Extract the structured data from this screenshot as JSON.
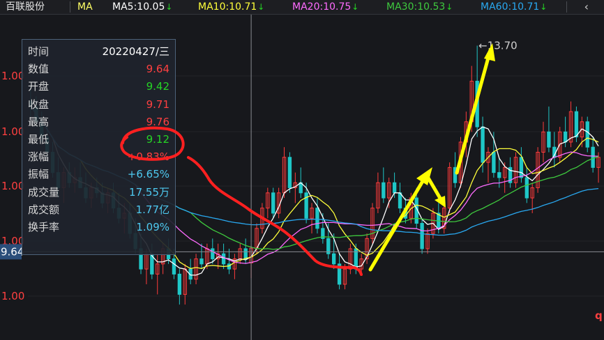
{
  "header": {
    "stock_name": "百联股份",
    "ma_label": "MA",
    "ma": [
      {
        "label": "MA5:10.05",
        "color": "#ffffff"
      },
      {
        "label": "MA10:10.71",
        "color": "#ffff3a"
      },
      {
        "label": "MA20:10.75",
        "color": "#ff6bff"
      },
      {
        "label": "MA30:10.53",
        "color": "#3ec93e"
      },
      {
        "label": "MA60:10.71",
        "color": "#29a8f0"
      }
    ],
    "down_arrow": "↓",
    "back_icon": "‹"
  },
  "tooltip": {
    "rows": [
      {
        "label": "时间",
        "value": "20220427/三",
        "color": "#ffffff"
      },
      {
        "label": "数值",
        "value": "9.64",
        "color": "#ff4040"
      },
      {
        "label": "开盘",
        "value": "9.42",
        "color": "#25d425"
      },
      {
        "label": "收盘",
        "value": "9.71",
        "color": "#ff4040"
      },
      {
        "label": "最高",
        "value": "9.76",
        "color": "#ff4040"
      },
      {
        "label": "最低",
        "value": "9.12",
        "color": "#25d425"
      },
      {
        "label": "涨幅",
        "value": "+0.83%",
        "color": "#ff4040"
      },
      {
        "label": "振幅",
        "value": "+6.65%",
        "color": "#4ec9f0"
      },
      {
        "label": "成交量",
        "value": "17.55万",
        "color": "#4ec9f0"
      },
      {
        "label": "成交额",
        "value": "1.77亿",
        "color": "#4ec9f0"
      },
      {
        "label": "换手率",
        "value": "1.09%",
        "color": "#4ec9f0"
      }
    ]
  },
  "chart_data": {
    "type": "candlestick",
    "y_tick_labels": [
      "1.00",
      "1.00",
      "1.00",
      "1.00",
      "1.00"
    ],
    "crosshair_price_label": "9.64",
    "max_annotation": "←13.70",
    "max_value": 13.7,
    "corner_label": "q",
    "ylim": [
      8.3,
      14.2
    ],
    "up_color": "#ff3b3b",
    "down_color": "#1fc7c7",
    "candles": [
      [
        12.6,
        12.9,
        12.3,
        12.5
      ],
      [
        12.5,
        12.7,
        12.1,
        12.2
      ],
      [
        12.2,
        12.4,
        11.8,
        11.9
      ],
      [
        11.9,
        12.1,
        11.5,
        11.6
      ],
      [
        11.6,
        11.8,
        11.1,
        11.2
      ],
      [
        11.2,
        11.5,
        10.7,
        10.9
      ],
      [
        10.9,
        11.3,
        10.6,
        11.2
      ],
      [
        11.2,
        11.4,
        10.9,
        11.0
      ],
      [
        11.0,
        11.3,
        10.8,
        11.1
      ],
      [
        11.1,
        11.4,
        10.9,
        10.9
      ],
      [
        10.9,
        11.2,
        10.6,
        10.7
      ],
      [
        10.7,
        11.0,
        10.5,
        10.9
      ],
      [
        10.9,
        11.1,
        10.7,
        10.8
      ],
      [
        10.8,
        11.0,
        10.5,
        10.6
      ],
      [
        10.6,
        10.9,
        10.4,
        10.8
      ],
      [
        10.8,
        11.0,
        10.4,
        10.5
      ],
      [
        10.5,
        10.8,
        10.2,
        10.3
      ],
      [
        10.3,
        10.6,
        10.0,
        10.4
      ],
      [
        10.4,
        10.6,
        9.9,
        10.0
      ],
      [
        10.0,
        10.3,
        9.6,
        9.7
      ],
      [
        9.7,
        10.0,
        9.2,
        9.3
      ],
      [
        9.3,
        9.7,
        9.0,
        9.6
      ],
      [
        9.6,
        9.8,
        9.1,
        9.2
      ],
      [
        9.2,
        9.6,
        8.8,
        9.4
      ],
      [
        9.4,
        9.8,
        9.2,
        9.7
      ],
      [
        9.7,
        9.9,
        9.4,
        9.5
      ],
      [
        9.5,
        9.7,
        9.1,
        9.2
      ],
      [
        9.2,
        9.3,
        8.6,
        8.8
      ],
      [
        8.8,
        9.4,
        8.6,
        9.3
      ],
      [
        9.3,
        9.5,
        9.0,
        9.1
      ],
      [
        9.1,
        9.6,
        9.0,
        9.5
      ],
      [
        9.5,
        9.8,
        9.3,
        9.4
      ],
      [
        9.4,
        9.8,
        9.3,
        9.7
      ],
      [
        9.7,
        9.9,
        9.4,
        9.5
      ],
      [
        9.5,
        9.8,
        9.3,
        9.6
      ],
      [
        9.6,
        9.8,
        9.3,
        9.4
      ],
      [
        9.4,
        9.7,
        9.2,
        9.3
      ],
      [
        9.3,
        9.6,
        9.1,
        9.5
      ],
      [
        9.5,
        9.8,
        9.4,
        9.7
      ],
      [
        9.7,
        9.9,
        9.4,
        9.5
      ],
      [
        9.42,
        9.76,
        9.12,
        9.71
      ],
      [
        9.7,
        10.2,
        9.6,
        10.1
      ],
      [
        10.1,
        10.6,
        10.0,
        10.5
      ],
      [
        10.5,
        10.9,
        10.3,
        10.8
      ],
      [
        10.8,
        10.9,
        10.3,
        10.4
      ],
      [
        10.4,
        10.9,
        10.3,
        10.8
      ],
      [
        10.8,
        11.7,
        10.7,
        11.5
      ],
      [
        11.5,
        11.6,
        10.8,
        10.9
      ],
      [
        10.9,
        11.2,
        10.6,
        11.0
      ],
      [
        11.0,
        11.3,
        10.7,
        10.8
      ],
      [
        10.8,
        11.0,
        10.2,
        10.3
      ],
      [
        10.3,
        10.6,
        10.0,
        10.5
      ],
      [
        10.5,
        10.7,
        10.0,
        10.1
      ],
      [
        10.1,
        10.4,
        9.8,
        9.9
      ],
      [
        9.9,
        10.2,
        9.5,
        9.6
      ],
      [
        9.6,
        10.0,
        9.3,
        9.4
      ],
      [
        9.4,
        9.6,
        8.9,
        9.0
      ],
      [
        9.0,
        9.4,
        8.9,
        9.3
      ],
      [
        9.3,
        9.8,
        9.2,
        9.7
      ],
      [
        9.7,
        9.8,
        9.2,
        9.3
      ],
      [
        9.3,
        9.6,
        9.2,
        9.5
      ],
      [
        9.5,
        10.0,
        9.4,
        9.9
      ],
      [
        9.9,
        10.6,
        9.8,
        10.5
      ],
      [
        10.5,
        11.2,
        10.4,
        11.0
      ],
      [
        11.0,
        11.3,
        10.6,
        10.7
      ],
      [
        10.7,
        11.1,
        10.5,
        11.0
      ],
      [
        11.0,
        11.2,
        10.7,
        10.8
      ],
      [
        10.8,
        11.0,
        10.4,
        10.5
      ],
      [
        10.5,
        10.7,
        10.2,
        10.3
      ],
      [
        10.3,
        10.8,
        10.2,
        10.7
      ],
      [
        10.7,
        10.9,
        10.1,
        10.2
      ],
      [
        10.2,
        10.3,
        9.6,
        9.7
      ],
      [
        9.7,
        10.1,
        9.6,
        10.0
      ],
      [
        10.0,
        10.5,
        9.9,
        10.4
      ],
      [
        10.4,
        10.6,
        10.0,
        10.1
      ],
      [
        10.1,
        10.6,
        10.0,
        10.5
      ],
      [
        10.5,
        11.4,
        10.4,
        11.3
      ],
      [
        11.3,
        11.6,
        10.9,
        11.0
      ],
      [
        11.0,
        11.9,
        10.9,
        11.8
      ],
      [
        11.8,
        12.4,
        11.5,
        12.2
      ],
      [
        12.2,
        13.3,
        12.0,
        13.0
      ],
      [
        13.0,
        13.7,
        11.9,
        12.1
      ],
      [
        12.1,
        12.3,
        11.2,
        11.4
      ],
      [
        11.4,
        11.7,
        11.0,
        11.6
      ],
      [
        11.6,
        12.0,
        11.1,
        11.2
      ],
      [
        11.2,
        11.5,
        10.9,
        11.1
      ],
      [
        11.1,
        11.4,
        10.8,
        11.3
      ],
      [
        11.3,
        11.5,
        10.9,
        11.0
      ],
      [
        11.0,
        11.6,
        10.9,
        11.5
      ],
      [
        11.5,
        11.7,
        11.0,
        11.1
      ],
      [
        11.1,
        11.3,
        10.6,
        10.7
      ],
      [
        10.7,
        11.0,
        10.4,
        10.9
      ],
      [
        10.9,
        11.7,
        10.8,
        11.6
      ],
      [
        11.6,
        12.2,
        11.4,
        12.0
      ],
      [
        12.0,
        12.5,
        11.6,
        11.7
      ],
      [
        11.7,
        12.0,
        11.3,
        11.5
      ],
      [
        11.5,
        12.1,
        11.4,
        12.0
      ],
      [
        12.0,
        12.3,
        11.7,
        11.8
      ],
      [
        11.8,
        12.6,
        11.7,
        12.4
      ],
      [
        12.4,
        12.5,
        11.8,
        11.9
      ],
      [
        11.9,
        12.3,
        11.7,
        12.2
      ],
      [
        12.2,
        12.3,
        11.6,
        11.7
      ],
      [
        11.7,
        11.9,
        11.2,
        11.3
      ],
      [
        11.3,
        11.6,
        11.0,
        11.5
      ]
    ]
  }
}
